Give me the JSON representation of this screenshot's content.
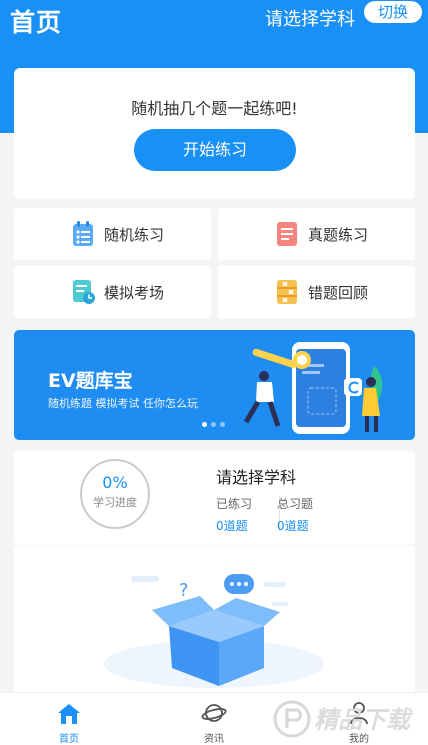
{
  "header": {
    "title": "首页",
    "subject_select": "请选择学科",
    "switch_label": "切换"
  },
  "practice_card": {
    "prompt": "随机抽几个题一起练吧!",
    "start_label": "开始练习"
  },
  "modes": [
    {
      "label": "随机练习",
      "icon": "list-icon",
      "color": "#4aa0f5"
    },
    {
      "label": "真题练习",
      "icon": "document-icon",
      "color": "#f4706c"
    },
    {
      "label": "模拟考场",
      "icon": "exam-clock-icon",
      "color": "#36c2c9"
    },
    {
      "label": "错题回顾",
      "icon": "wrong-review-icon",
      "color": "#f5b53e"
    }
  ],
  "banner": {
    "title": "EV题库宝",
    "subtitle": "随机练题 模拟考试 任你怎么玩",
    "active_slide": 1,
    "slide_count": 3
  },
  "progress": {
    "percent_text": "0%",
    "percent_label": "学习进度",
    "subject": "请选择学科",
    "stats": [
      {
        "label": "已练习",
        "value": "0道题"
      },
      {
        "label": "总习题",
        "value": "0道题"
      }
    ]
  },
  "tabbar": {
    "tabs": [
      {
        "label": "首页",
        "icon": "home-icon",
        "active": true
      },
      {
        "label": "资讯",
        "icon": "planet-icon",
        "active": false
      },
      {
        "label": "我的",
        "icon": "profile-icon",
        "active": false
      }
    ]
  },
  "watermark": {
    "text": "精品下载"
  },
  "colors": {
    "primary": "#1890f5",
    "background": "#f4f5f7",
    "card": "#ffffff"
  }
}
